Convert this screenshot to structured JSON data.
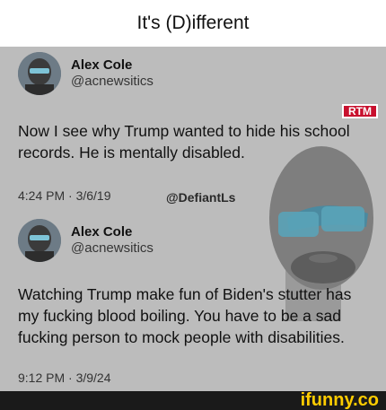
{
  "title": "It's (D)ifferent",
  "badge": "RTM",
  "watermark": "@DefiantLs",
  "footer_logo": "ifunny.co",
  "tweets": [
    {
      "display_name": "Alex Cole",
      "handle": "@acnewsitics",
      "text": "Now I see why Trump wanted to hide his school records. He is mentally disabled.",
      "time": "4:24 PM · 3/6/19"
    },
    {
      "display_name": "Alex Cole",
      "handle": "@acnewsitics",
      "text": "Watching Trump make fun of Biden's stutter has my fucking blood boiling. You have to be a sad fucking person to mock people with disabilities.",
      "time": "9:12 PM · 3/9/24"
    }
  ],
  "colors": {
    "panel_bg": "#bcbcbc",
    "badge_red": "#c8102e",
    "footer_bg": "#1a1a1a",
    "logo_yellow": "#ffcc00"
  }
}
